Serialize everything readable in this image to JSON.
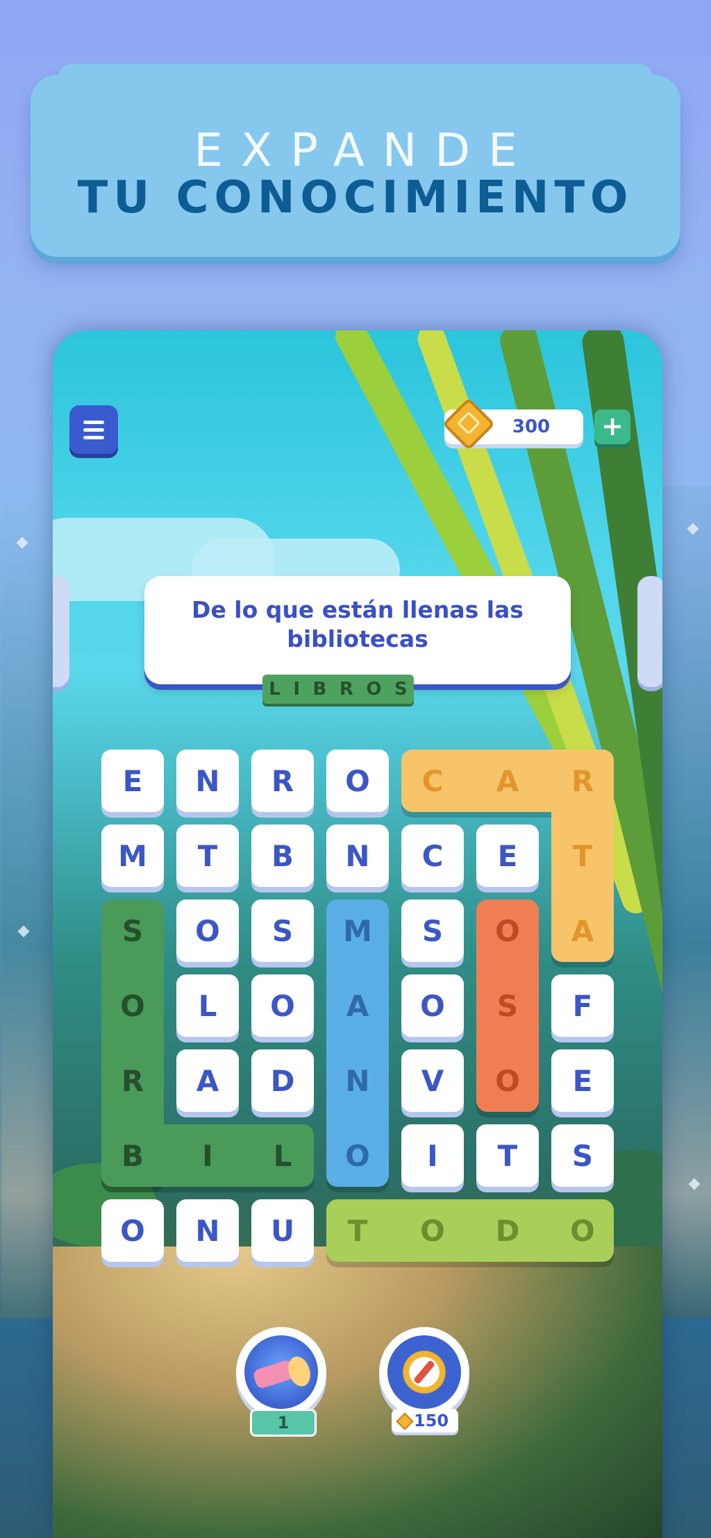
{
  "banner": {
    "line1": "EXPANDE",
    "line2": "TU CONOCIMIENTO"
  },
  "header": {
    "coins": "300",
    "plus_label": "+"
  },
  "clue": {
    "text": "De lo que están llenas las bibliotecas",
    "answer_letters": [
      "L",
      "I",
      "B",
      "R",
      "O",
      "S"
    ]
  },
  "grid": {
    "rows": [
      [
        "E",
        "N",
        "R",
        "O",
        "C",
        "A",
        "R"
      ],
      [
        "M",
        "T",
        "B",
        "N",
        "C",
        "E",
        "T"
      ],
      [
        "S",
        "O",
        "S",
        "M",
        "S",
        "O",
        "A"
      ],
      [
        "O",
        "L",
        "O",
        "A",
        "O",
        "S",
        "F"
      ],
      [
        "R",
        "A",
        "D",
        "N",
        "V",
        "O",
        "E"
      ],
      [
        "B",
        "I",
        "L",
        "O",
        "I",
        "T",
        "S"
      ],
      [
        "O",
        "N",
        "U",
        "T",
        "O",
        "D",
        "O"
      ]
    ],
    "found_words": [
      {
        "word": "CARTA",
        "color": "#f7c46a",
        "text_color": "#e3952c"
      },
      {
        "word": "LIBROS",
        "color": "#4a9a5a",
        "text_color": "#24502c"
      },
      {
        "word": "MANO",
        "color": "#5aaee6",
        "text_color": "#2f6aa8"
      },
      {
        "word": "OSO",
        "color": "#ef7f52",
        "text_color": "#bf4a26"
      },
      {
        "word": "TODO",
        "color": "#a9cf5a",
        "text_color": "#6c8f2e"
      }
    ]
  },
  "tools": {
    "flashlight_count": "1",
    "compass_cost": "150"
  },
  "colors": {
    "primary": "#3a56c8",
    "banner_bg": "#86c7ee",
    "banner_title": "#0d5c93"
  }
}
